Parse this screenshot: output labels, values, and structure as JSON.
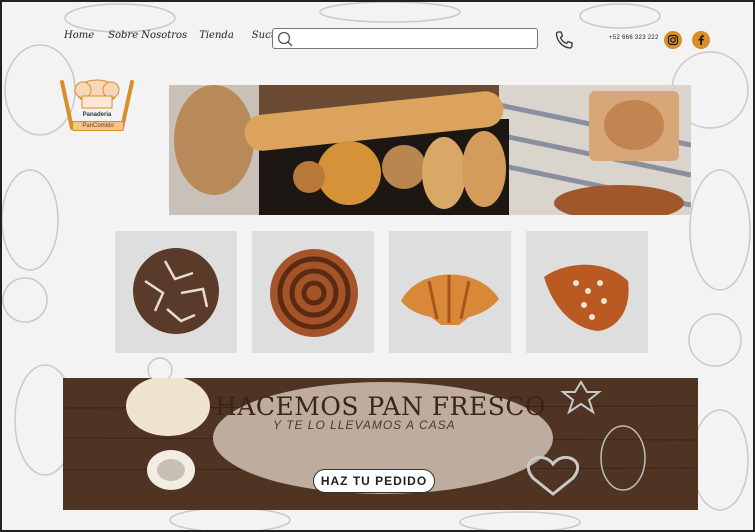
{
  "nav": {
    "items": [
      {
        "label": "Home"
      },
      {
        "label": "Sobre Nosotros"
      },
      {
        "label": "Tienda"
      },
      {
        "label": "Sucursales"
      }
    ]
  },
  "search": {
    "placeholder": "",
    "value": ""
  },
  "contact": {
    "phone": "+52 666 323 222"
  },
  "social": {
    "icons": [
      "instagram-icon",
      "facebook-icon"
    ]
  },
  "logo": {
    "title": "Panaderia",
    "subtitle": "PanComido"
  },
  "products": [
    {
      "icon": "bread-loaf"
    },
    {
      "icon": "cinnamon-roll"
    },
    {
      "icon": "croissant"
    },
    {
      "icon": "pastry"
    }
  ],
  "banner": {
    "title": "HACEMOS PAN FRESCO",
    "subtitle": "Y TE LO LLEVAMOS A CASA",
    "button_label": "HAZ TU PEDIDO"
  },
  "colors": {
    "accent": "#d98e2a",
    "banner_text": "#3b2418",
    "wood": "#5a3a28"
  }
}
